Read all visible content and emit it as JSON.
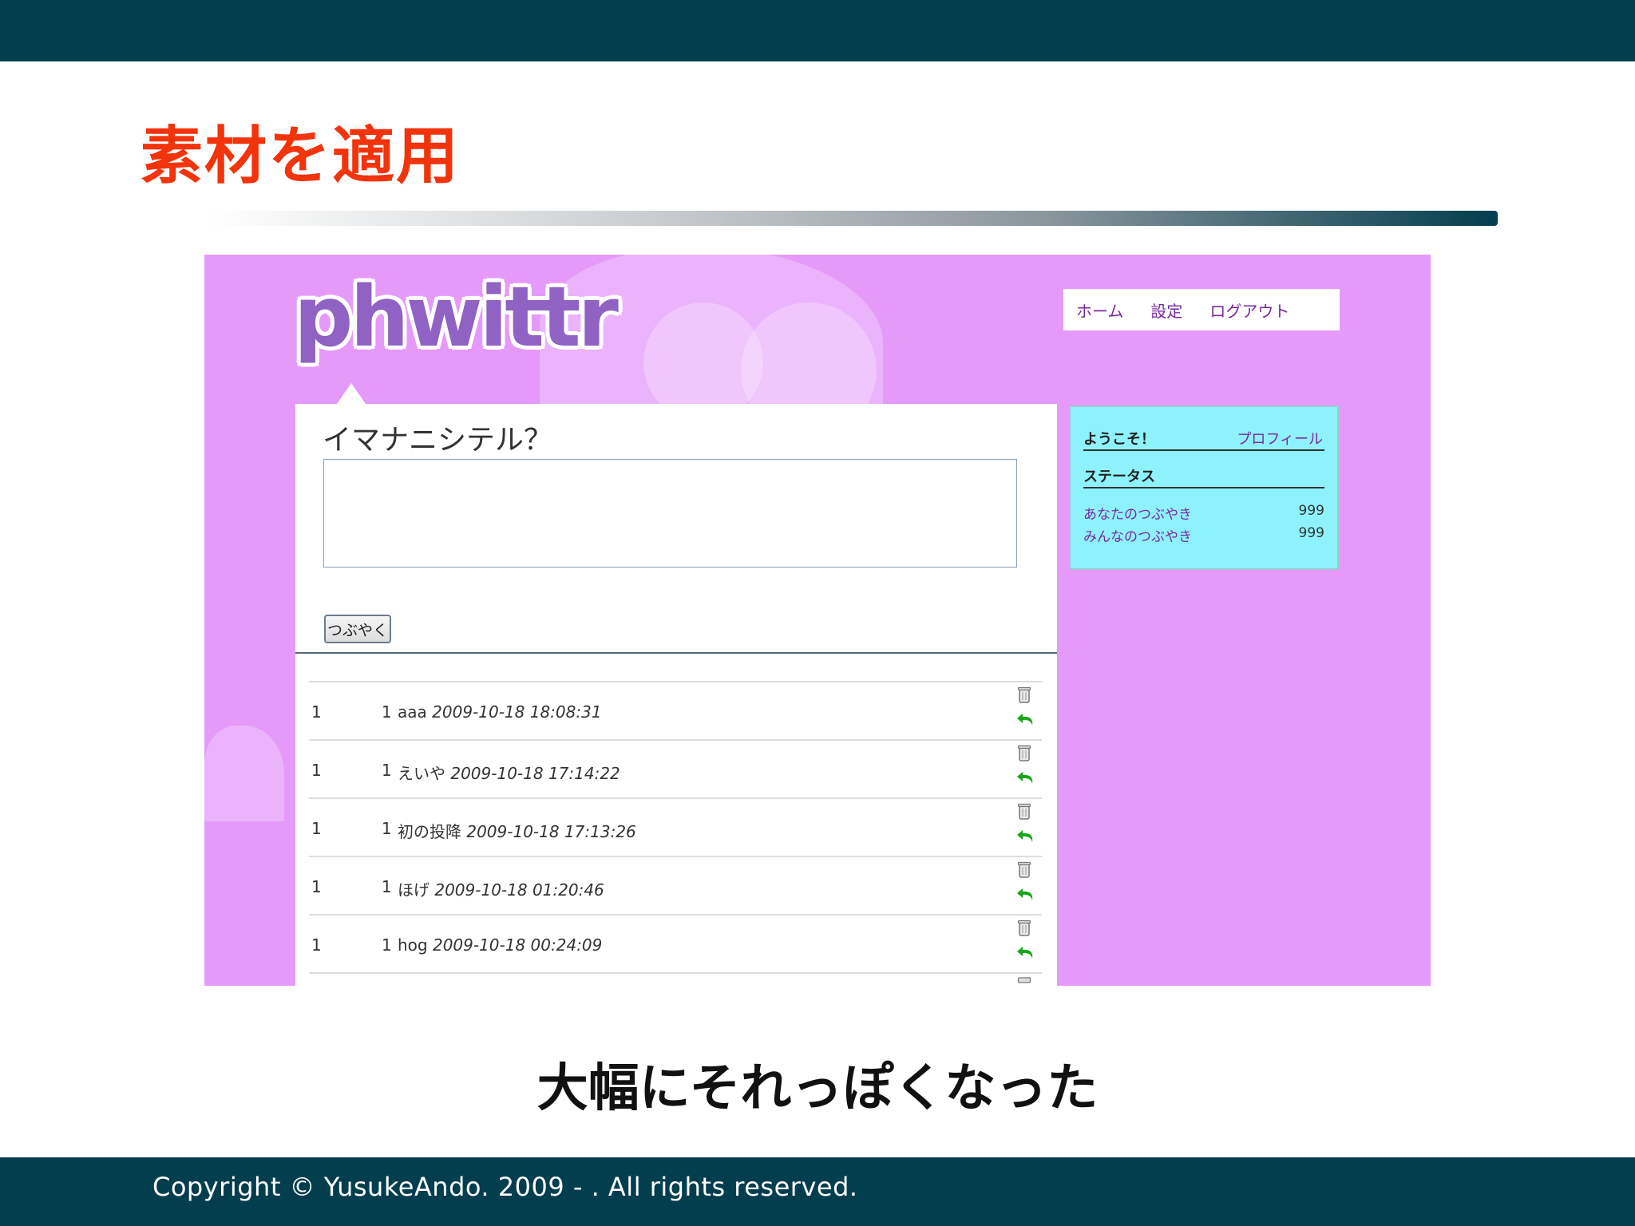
{
  "slide": {
    "title": "素材を適用",
    "caption": "大幅にそれっぽくなった",
    "copyright": "Copyright © YusukeAndo. 2009 - . All rights reserved."
  },
  "app": {
    "logo": "phwittr",
    "nav": {
      "home": "ホーム",
      "settings": "設定",
      "logout": "ログアウト"
    },
    "post_prompt": "イマナニシテル？",
    "post_input_value": "",
    "post_button": "つぶやく",
    "tweets": [
      {
        "num": "1",
        "user_id": "1",
        "text": "aaa",
        "date": "2009-10-18 18:08:31"
      },
      {
        "num": "1",
        "user_id": "1",
        "text": "えいや",
        "date": "2009-10-18 17:14:22"
      },
      {
        "num": "1",
        "user_id": "1",
        "text": "初の投降",
        "date": "2009-10-18 17:13:26"
      },
      {
        "num": "1",
        "user_id": "1",
        "text": "ほげ",
        "date": "2009-10-18 01:20:46"
      },
      {
        "num": "1",
        "user_id": "1",
        "text": "hog",
        "date": "2009-10-18 00:24:09"
      }
    ],
    "sidebar": {
      "welcome": "ようこそ！",
      "profile_link": "プロフィール",
      "status_heading": "ステータス",
      "stats": [
        {
          "label": "あなたのつぶやき",
          "value": "999"
        },
        {
          "label": "みんなのつぶやき",
          "value": "999"
        }
      ]
    }
  },
  "colors": {
    "header_bar": "#033e4f",
    "title_red": "#f2340c",
    "app_background": "#e59afa",
    "sidebar_background": "#8df2fb",
    "link_purple": "#7a2aa0",
    "reply_icon_green": "#1aa51a"
  },
  "icons": [
    "trash-icon",
    "reply-icon"
  ]
}
